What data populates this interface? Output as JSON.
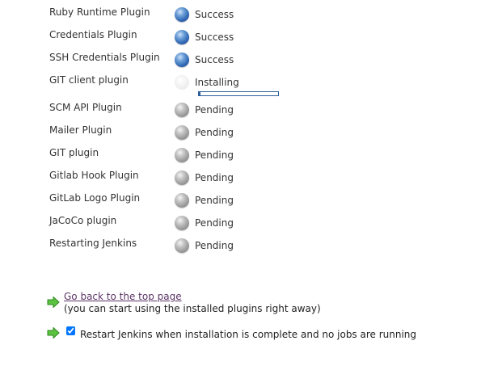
{
  "plugins": [
    {
      "name": "Ruby Runtime Plugin",
      "status": "Success",
      "state": "success"
    },
    {
      "name": "Credentials Plugin",
      "status": "Success",
      "state": "success"
    },
    {
      "name": "SSH Credentials Plugin",
      "status": "Success",
      "state": "success"
    },
    {
      "name": "GIT client plugin",
      "status": "Installing",
      "state": "installing",
      "progress": 0.02
    },
    {
      "name": "SCM API Plugin",
      "status": "Pending",
      "state": "pending"
    },
    {
      "name": "Mailer Plugin",
      "status": "Pending",
      "state": "pending"
    },
    {
      "name": "GIT plugin",
      "status": "Pending",
      "state": "pending"
    },
    {
      "name": "Gitlab Hook Plugin",
      "status": "Pending",
      "state": "pending"
    },
    {
      "name": "GitLab Logo Plugin",
      "status": "Pending",
      "state": "pending"
    },
    {
      "name": "JaCoCo plugin",
      "status": "Pending",
      "state": "pending"
    },
    {
      "name": "Restarting Jenkins",
      "status": "Pending",
      "state": "pending"
    }
  ],
  "footer": {
    "back_link": "Go back to the top page",
    "back_note": "(you can start using the installed plugins right away)",
    "restart_label": "Restart Jenkins when installation is complete and no jobs are running",
    "restart_checked": true
  },
  "icons": {
    "arrow": "green-arrow-icon",
    "success": "blue-ball-icon",
    "pending": "grey-ball-icon",
    "installing": "grey-anime-ball-icon"
  },
  "colors": {
    "success_ball": "#2f66b3",
    "pending_ball": "#9a9a9a",
    "progress": "#2c5f9a",
    "link": "#5c3566",
    "arrow": "#3fae2a"
  }
}
